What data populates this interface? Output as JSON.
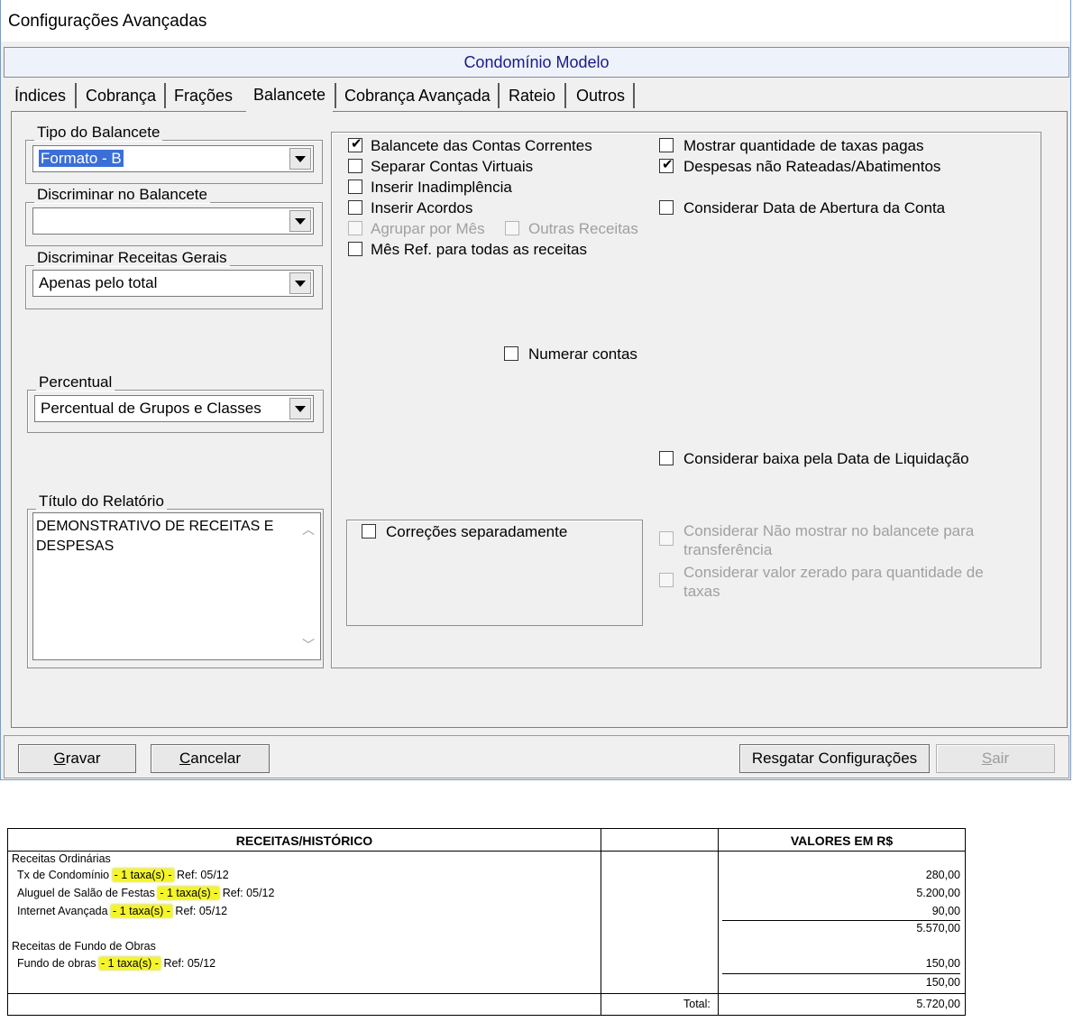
{
  "window": {
    "title": "Configurações Avançadas",
    "subtitle": "Condomínio Modelo"
  },
  "tabs": [
    "Índices",
    "Cobrança",
    "Frações",
    "Balancete",
    "Cobrança Avançada",
    "Rateio",
    "Outros"
  ],
  "active_tab": "Balancete",
  "groups": {
    "tipo": {
      "label": "Tipo do Balancete",
      "value": "Formato - B"
    },
    "discriminar": {
      "label": "Discriminar no Balancete",
      "value": ""
    },
    "receitas": {
      "label": "Discriminar Receitas Gerais",
      "value": "Apenas pelo total"
    },
    "percentual": {
      "label": "Percentual",
      "value": "Percentual de Grupos e Classes"
    },
    "titulo": {
      "label": "Título do Relatório",
      "value": "DEMONSTRATIVO DE RECEITAS E DESPESAS"
    }
  },
  "checkboxes": {
    "balancete_contas": {
      "label": "Balancete das Contas Correntes",
      "checked": true
    },
    "separar_contas": {
      "label": "Separar Contas Virtuais",
      "checked": false
    },
    "inserir_inadimplencia": {
      "label": "Inserir Inadimplência",
      "checked": false
    },
    "inserir_acordos": {
      "label": "Inserir Acordos",
      "checked": false
    },
    "agrupar_mes": {
      "label": "Agrupar por Mês",
      "checked": false,
      "disabled": true
    },
    "outras_receitas": {
      "label": "Outras Receitas",
      "checked": false,
      "disabled": true
    },
    "mes_ref": {
      "label": "Mês Ref. para todas as receitas",
      "checked": false
    },
    "numerar_contas": {
      "label": "Numerar contas",
      "checked": false
    },
    "correcoes": {
      "label": "Correções separadamente",
      "checked": false
    },
    "mostrar_qtd": {
      "label": "Mostrar quantidade de taxas pagas",
      "checked": false
    },
    "despesas_nao_rateadas": {
      "label": "Despesas não Rateadas/Abatimentos",
      "checked": true
    },
    "considerar_data_abertura": {
      "label": "Considerar Data de Abertura da Conta",
      "checked": false
    },
    "considerar_baixa": {
      "label": "Considerar baixa pela Data de Liquidação",
      "checked": false
    },
    "nao_mostrar_transf": {
      "label_1": "Considerar Não mostrar no balancete para",
      "label_2": "transferência",
      "checked": false,
      "disabled": true
    },
    "valor_zerado": {
      "label_1": "Considerar valor zerado para quantidade de",
      "label_2": "taxas",
      "checked": false,
      "disabled": true
    }
  },
  "buttons": {
    "gravar": {
      "pre": "",
      "ul": "G",
      "post": "ravar"
    },
    "cancelar": {
      "pre": "",
      "ul": "C",
      "post": "ancelar"
    },
    "resgatar": "Resgatar Configurações",
    "sair": {
      "pre": "",
      "ul": "S",
      "post": "air"
    }
  },
  "report": {
    "col1_header": "RECEITAS/HISTÓRICO",
    "col3_header": "VALORES EM R$",
    "groups": [
      {
        "name": "Receitas Ordinárias",
        "rows": [
          {
            "label": "Tx de Condomínio",
            "highlight": "- 1 taxa(s) -",
            "ref": "Ref: 05/12",
            "value": "280,00"
          },
          {
            "label": "Aluguel de Salão de Festas",
            "highlight": "- 1 taxa(s) -",
            "ref": "Ref: 05/12",
            "value": "5.200,00"
          },
          {
            "label": "Internet Avançada",
            "highlight": "- 1 taxa(s) -",
            "ref": "Ref: 05/12",
            "value": "90,00"
          }
        ],
        "subtotal": "5.570,00"
      },
      {
        "name": "Receitas de Fundo de Obras",
        "rows": [
          {
            "label": "Fundo de obras",
            "highlight": "- 1 taxa(s) -",
            "ref": "Ref: 05/12",
            "value": "150,00"
          }
        ],
        "subtotal": "150,00"
      }
    ],
    "total_label": "Total:",
    "total_value": "5.720,00"
  }
}
